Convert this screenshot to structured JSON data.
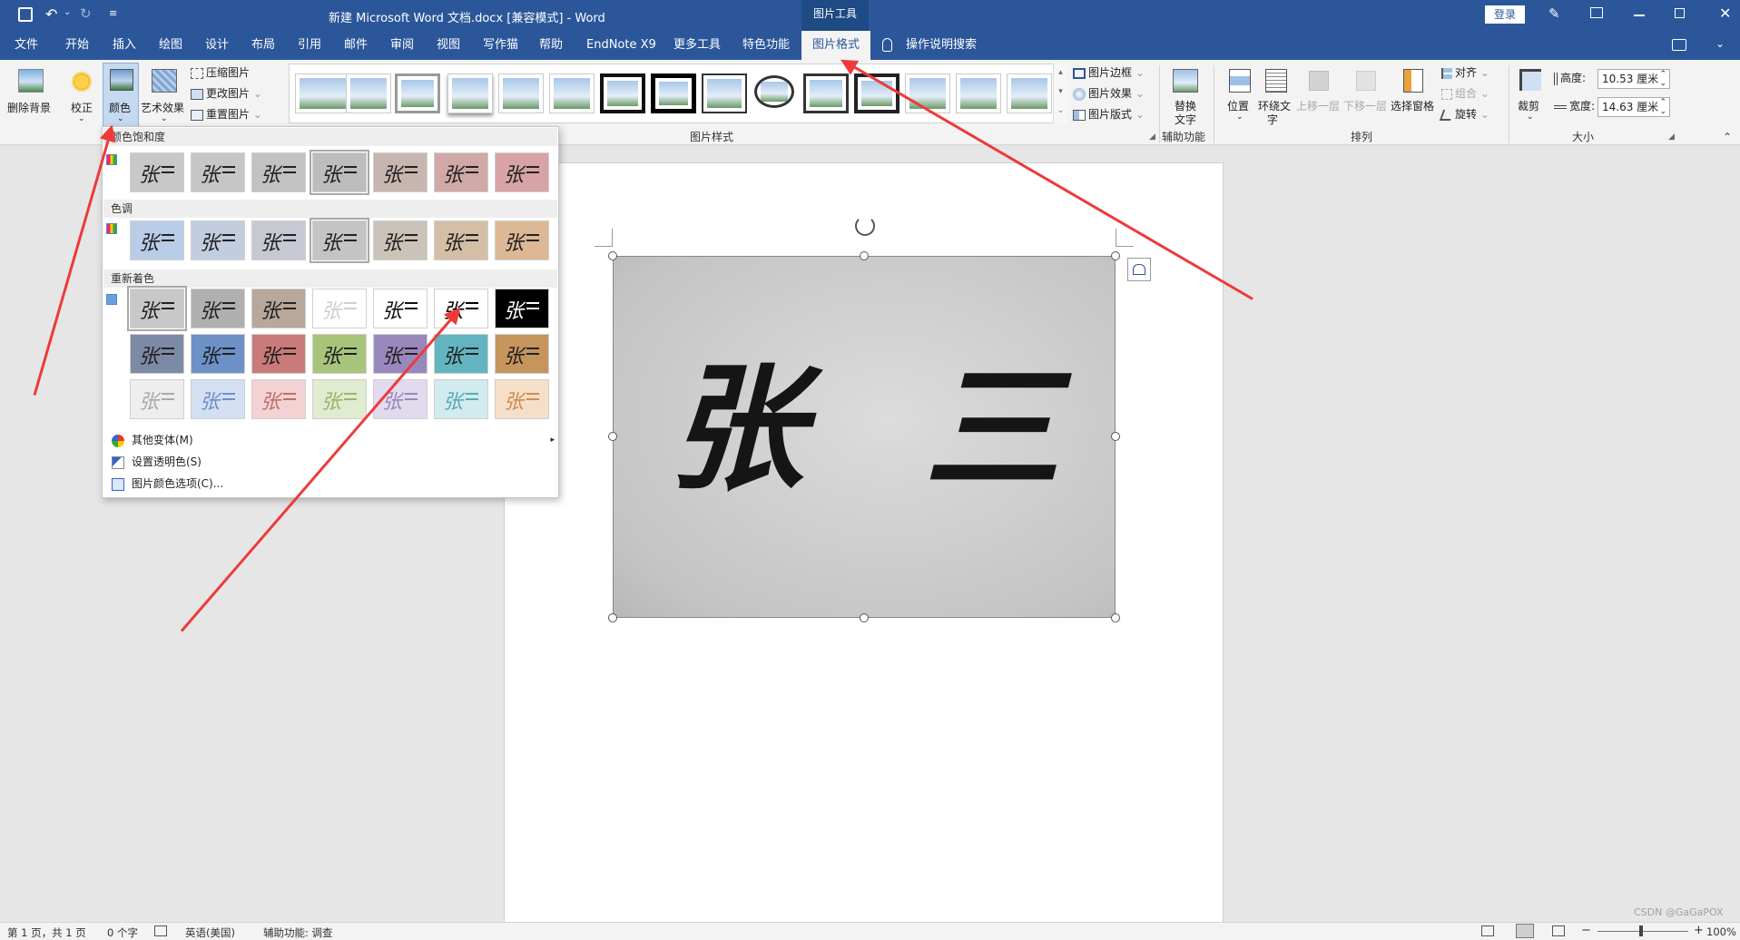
{
  "title_bar": {
    "document_title": "新建 Microsoft Word 文档.docx [兼容模式]  -  Word",
    "context_tab_group": "图片工具",
    "login_button": "登录"
  },
  "tabs": [
    "文件",
    "开始",
    "插入",
    "绘图",
    "设计",
    "布局",
    "引用",
    "邮件",
    "审阅",
    "视图",
    "写作猫",
    "帮助",
    "EndNote X9",
    "更多工具",
    "特色功能",
    "图片格式"
  ],
  "active_tab": "图片格式",
  "tell_me": "操作说明搜索",
  "ribbon": {
    "adjust": {
      "remove_bg": "删除背景",
      "correct": "校正",
      "color": "颜色",
      "artistic": "艺术效果",
      "compress": "压缩图片",
      "change": "更改图片",
      "reset": "重置图片"
    },
    "styles": {
      "group_label": "图片样式",
      "border": "图片边框",
      "effects": "图片效果",
      "layout": "图片版式"
    },
    "accessibility": {
      "alt_text_line1": "替换",
      "alt_text_line2": "文字",
      "group_label": "辅助功能"
    },
    "arrange": {
      "position": "位置",
      "wrap_line1": "环绕文",
      "wrap_line2": "字",
      "bring_forward": "上移一层",
      "send_backward": "下移一层",
      "selection_pane": "选择窗格",
      "align": "对齐",
      "group": "组合",
      "rotate": "旋转",
      "group_label": "排列"
    },
    "size": {
      "crop": "裁剪",
      "height_label": "高度:",
      "height_value": "10.53 厘米",
      "width_label": "宽度:",
      "width_value": "14.63 厘米",
      "group_label": "大小"
    }
  },
  "color_menu": {
    "saturation_header": "颜色饱和度",
    "tone_header": "色调",
    "recolor_header": "重新着色",
    "swatch_text": "张 三",
    "more_variations": "其他变体(M)",
    "set_transparent": "设置透明色(S)",
    "color_options": "图片颜色选项(C)..."
  },
  "status_bar": {
    "page": "第 1 页，共 1 页",
    "words": "0 个字",
    "language": "英语(美国)",
    "accessibility": "辅助功能: 调查",
    "zoom": "100%",
    "watermark": "CSDN @GaGaPOX"
  },
  "picture": {
    "text": "张 三"
  },
  "colors": {
    "accent": "#2b579a",
    "arrow": "#ee3a3a"
  }
}
